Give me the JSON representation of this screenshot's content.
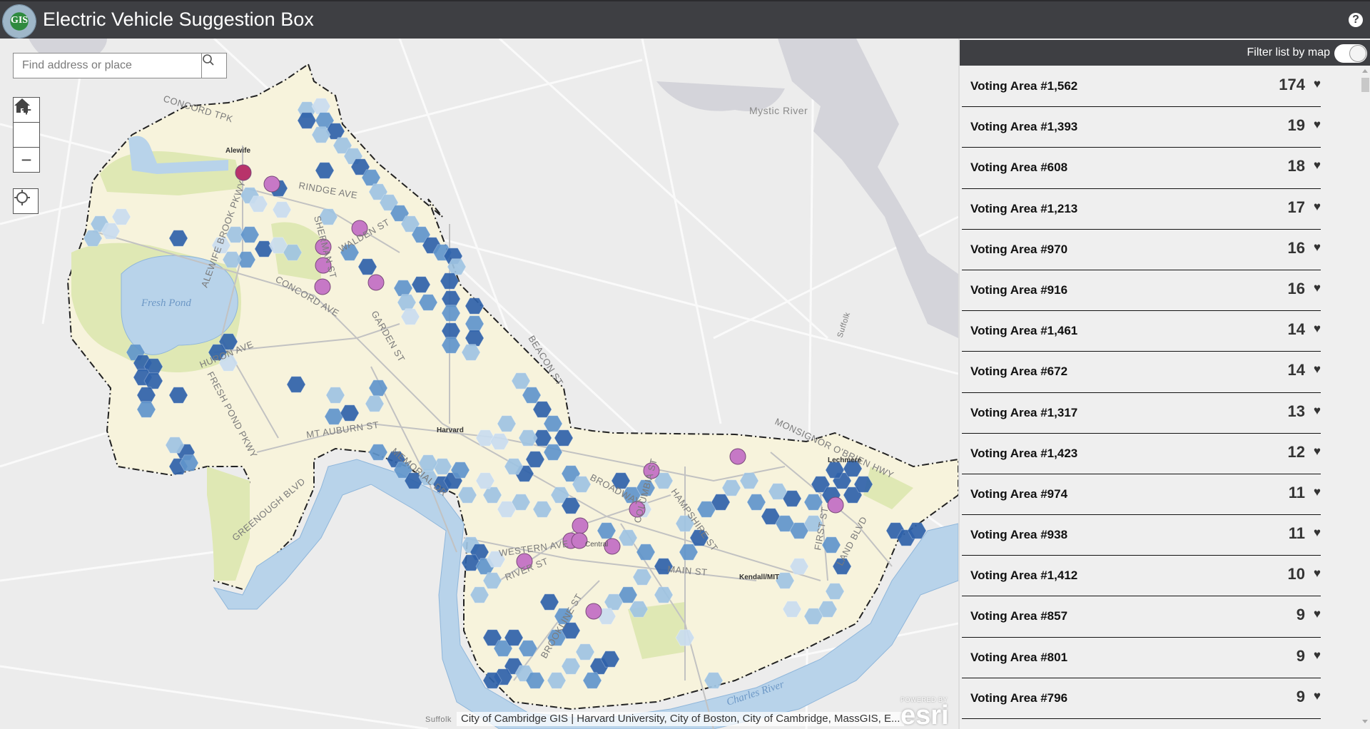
{
  "app": {
    "title": "Electric Vehicle Suggestion Box",
    "logo_text": "GIS",
    "help_icon": "?"
  },
  "search": {
    "placeholder": "Find address or place",
    "value": ""
  },
  "map_controls": {
    "zoom_in": "+",
    "zoom_out": "−"
  },
  "map_labels": {
    "mystic_river": "Mystic River",
    "fresh_pond": "Fresh Pond",
    "charles_river": "Charles River",
    "concord_tpk": "CONCORD TPK",
    "alewife": "Alewife",
    "rindge_ave": "RINDGE AVE",
    "alewife_brook_pkwy": "ALEWIFE BROOK PKWY",
    "sherman_st": "SHERMAN ST",
    "walden_st": "WALDEN ST",
    "concord_ave": "CONCORD AVE",
    "garden_st": "GARDEN ST",
    "huron_ave": "HURON AVE",
    "fresh_pond_pkwy": "FRESH POND PKWY",
    "mt_auburn_st": "MT AUBURN ST",
    "greenough_blvd": "GREENOUGH BLVD",
    "memorial_dr": "MEMORIAL DR",
    "harvard": "Harvard",
    "beacon_st": "BEACON ST",
    "broadway": "BROADWAY",
    "columbia_st": "COLUMBIA ST",
    "hampshire_st": "HAMPSHIRE ST",
    "western_ave": "WESTERN AVE",
    "river_st": "RIVER ST",
    "main_st": "MAIN ST",
    "kendall_mit": "Kendall/MIT",
    "brookline_st": "BROOKLINE ST",
    "monsignor_obrien_hwy": "MONSIGNOR O'BRIEN HWY",
    "first_st": "FIRST ST",
    "land_blvd": "LAND BLVD",
    "lechmere": "Lechmere",
    "suffolk_1": "Suffolk",
    "suffolk_2": "Suffolk",
    "central": "Central"
  },
  "attribution": "City of Cambridge GIS | Harvard University, City of Boston, City of Cambridge, MassGIS, E...",
  "esri": {
    "powered_by": "POWERED BY",
    "name": "esri"
  },
  "legend_colors": {
    "hex_level_1": "#c9dcef",
    "hex_level_2": "#9ec3e2",
    "hex_level_3": "#5f95cb",
    "hex_level_4": "#2f62a9",
    "suggestion_point": "#c678c6",
    "selected_point": "#b8336a",
    "cambridge_area": "#f7f3dc",
    "water": "#b8d3ea",
    "park": "#dfe8b4"
  },
  "panel": {
    "filter_label": "Filter list by map",
    "filter_on": true,
    "items": [
      {
        "name": "Voting Area #1,562",
        "votes": "174"
      },
      {
        "name": "Voting Area #1,393",
        "votes": "19"
      },
      {
        "name": "Voting Area #608",
        "votes": "18"
      },
      {
        "name": "Voting Area #1,213",
        "votes": "17"
      },
      {
        "name": "Voting Area #970",
        "votes": "16"
      },
      {
        "name": "Voting Area #916",
        "votes": "16"
      },
      {
        "name": "Voting Area #1,461",
        "votes": "14"
      },
      {
        "name": "Voting Area #672",
        "votes": "14"
      },
      {
        "name": "Voting Area #1,317",
        "votes": "13"
      },
      {
        "name": "Voting Area #1,423",
        "votes": "12"
      },
      {
        "name": "Voting Area #974",
        "votes": "11"
      },
      {
        "name": "Voting Area #938",
        "votes": "11"
      },
      {
        "name": "Voting Area #1,412",
        "votes": "10"
      },
      {
        "name": "Voting Area #857",
        "votes": "9"
      },
      {
        "name": "Voting Area #801",
        "votes": "9"
      },
      {
        "name": "Voting Area #796",
        "votes": "9"
      }
    ]
  }
}
